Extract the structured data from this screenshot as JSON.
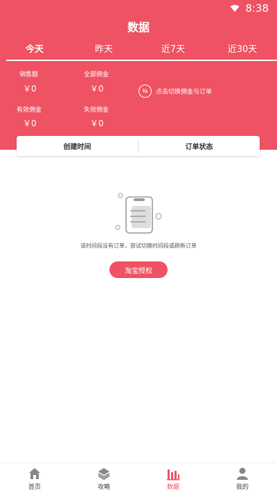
{
  "status": {
    "time": "8:38",
    "wifi_icon": "wifi-icon"
  },
  "header": {
    "title": "数据"
  },
  "tabs": [
    {
      "label": "今天",
      "active": true
    },
    {
      "label": "昨天",
      "active": false
    },
    {
      "label": "近7天",
      "active": false
    },
    {
      "label": "近30天",
      "active": false
    }
  ],
  "stats": {
    "sales_label": "销售额",
    "sales_value": "￥0",
    "total_commission_label": "全部佣金",
    "total_commission_value": "￥0",
    "valid_commission_label": "有效佣金",
    "valid_commission_value": "￥0",
    "invalid_commission_label": "失效佣金",
    "invalid_commission_value": "￥0"
  },
  "switch": {
    "label": "点击切换佣金与订单",
    "icon": "switch-icon"
  },
  "filters": {
    "created_time": "创建时间",
    "order_status": "订单状态"
  },
  "empty": {
    "message": "该时间段没有订单，尝试切换时间段或刷新订单"
  },
  "auth_button": "淘宝授权",
  "bottom_nav": [
    {
      "label": "首页",
      "icon": "home-icon",
      "active": false
    },
    {
      "label": "攻略",
      "icon": "layers-icon",
      "active": false
    },
    {
      "label": "数据",
      "icon": "chart-icon",
      "active": true
    },
    {
      "label": "我的",
      "icon": "user-icon",
      "active": false
    }
  ],
  "colors": {
    "accent": "#ee5263"
  }
}
